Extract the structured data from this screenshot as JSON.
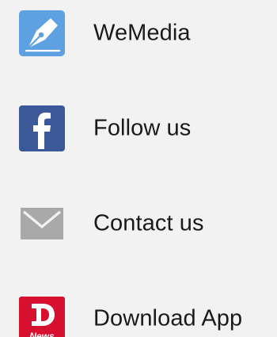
{
  "menu": {
    "items": [
      {
        "label": "WeMedia",
        "icon": "pen-nib-icon",
        "color": "#5da1e3"
      },
      {
        "label": "Follow us",
        "icon": "facebook-icon",
        "color": "#3b5998"
      },
      {
        "label": "Contact us",
        "icon": "envelope-icon",
        "color": "#a9a9a9"
      },
      {
        "label": "Download App",
        "icon": "dailynews-app-icon",
        "color": "#d7102f",
        "icon_text": "News"
      }
    ]
  }
}
